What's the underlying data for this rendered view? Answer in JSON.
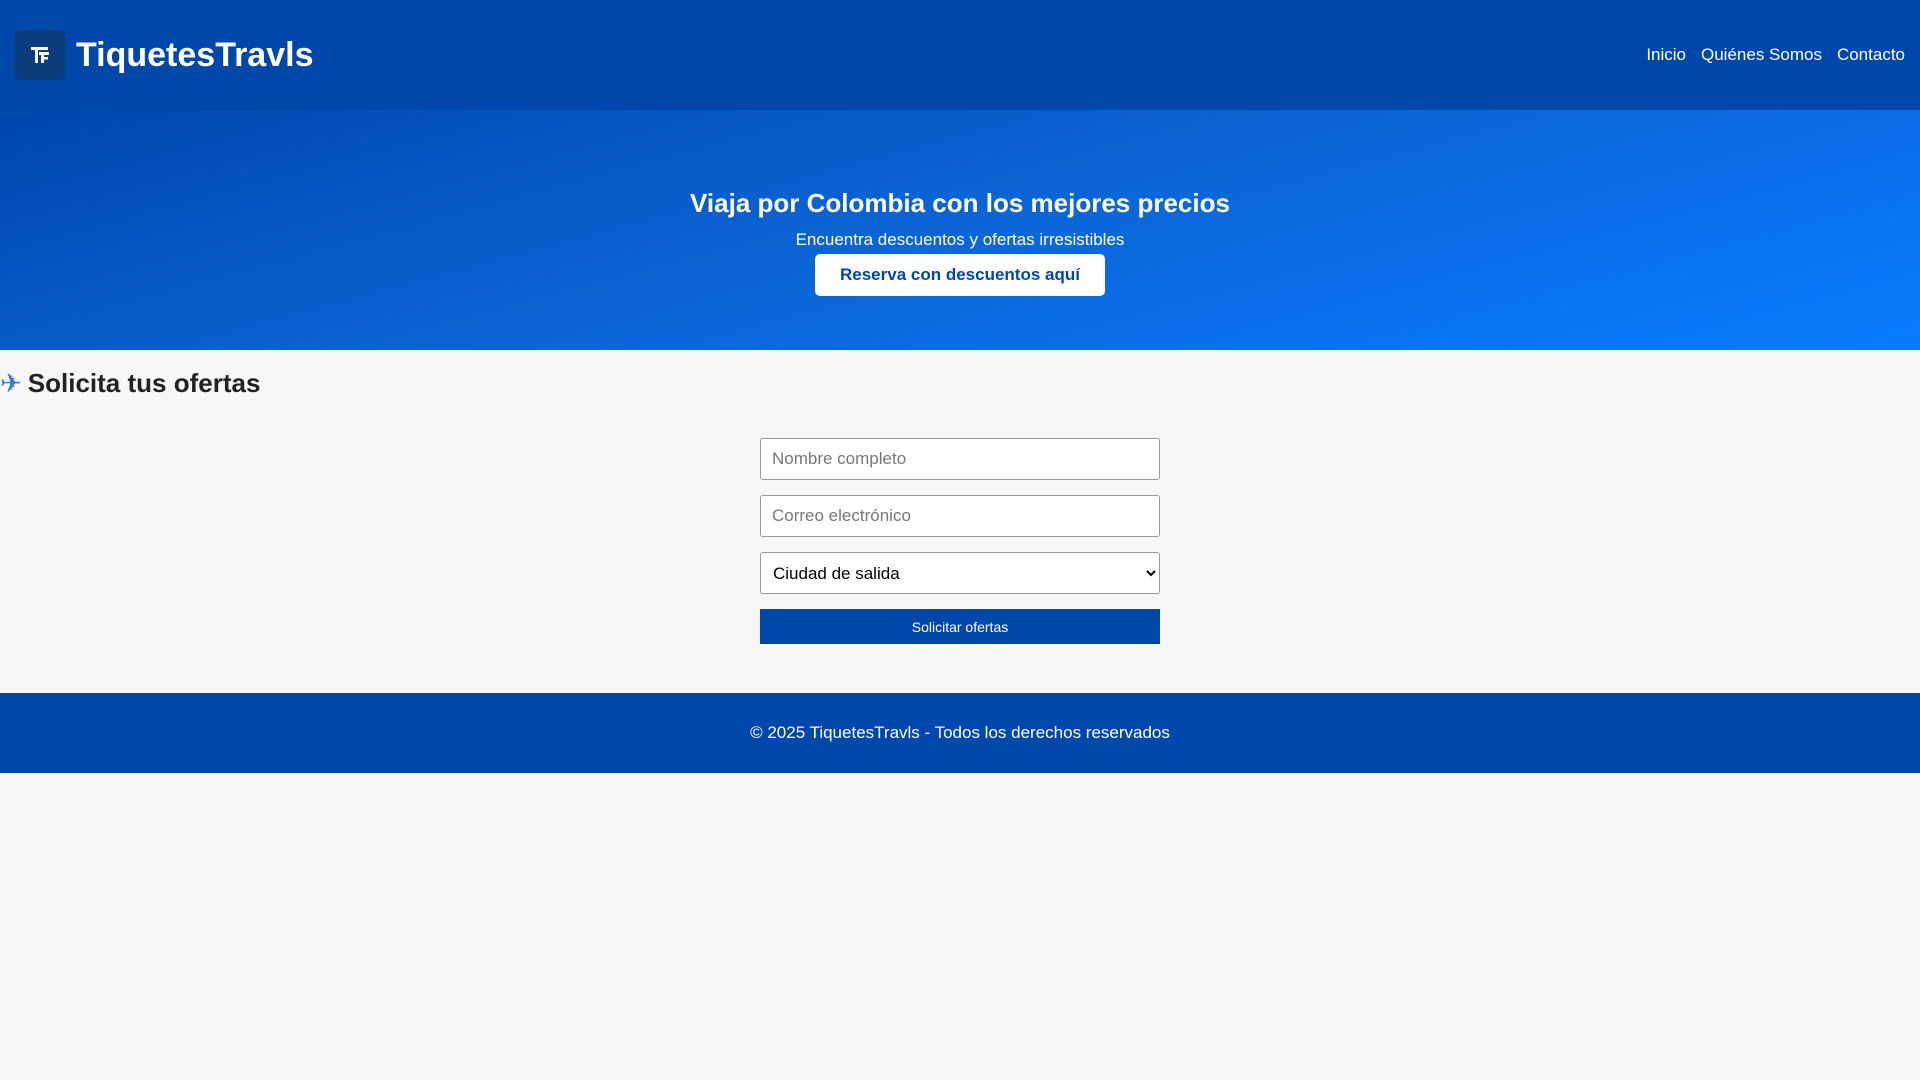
{
  "header": {
    "brand_name": "TiquetesTravls",
    "nav": [
      "Inicio",
      "Quiénes Somos",
      "Contacto"
    ]
  },
  "hero": {
    "title": "Viaja por Colombia con los mejores precios",
    "subtitle": "Encuentra descuentos y ofertas irresistibles",
    "cta_label": "Reserva con descuentos aquí"
  },
  "form": {
    "section_title": "Solicita tus ofertas",
    "icon": "airplane-icon",
    "name_placeholder": "Nombre completo",
    "email_placeholder": "Correo electrónico",
    "city_selected": "Ciudad de salida",
    "submit_label": "Solicitar ofertas"
  },
  "footer": {
    "text": "© 2025 TiquetesTravls - Todos los derechos reservados"
  },
  "colors": {
    "primary": "#0047ab",
    "hero_light": "#0a7cff",
    "background": "#f7f7f7"
  }
}
